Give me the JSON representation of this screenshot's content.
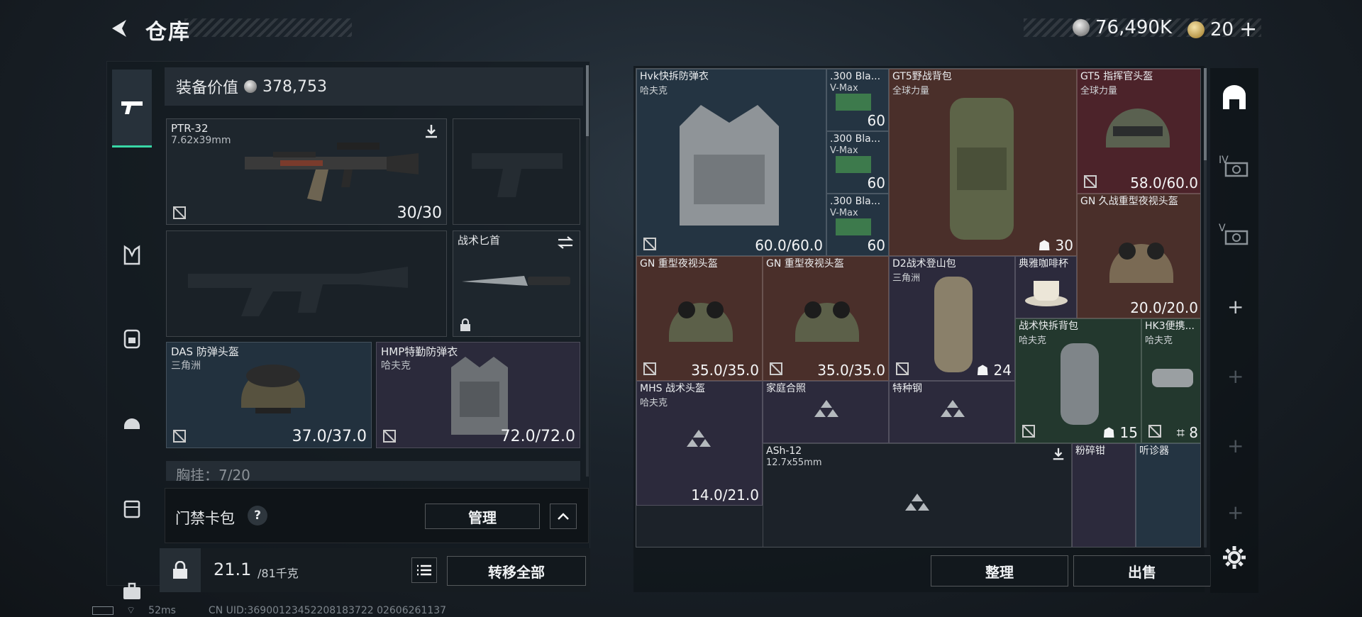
{
  "header": {
    "title": "仓库",
    "silver_amount": "76,490K",
    "gold_amount": "20",
    "gold_plus": "+"
  },
  "left": {
    "tabs": [
      "weapon-icon",
      "vest-icon",
      "backpack-icon",
      "helmet-icon",
      "case-icon",
      "briefcase-icon"
    ],
    "equipment_value_label": "装备价值",
    "equipment_value": "378,753",
    "primary": {
      "name": "PTR-32",
      "caliber": "7.62x39mm",
      "ammo": "30/30"
    },
    "melee": {
      "name": "战术匕首"
    },
    "helmet": {
      "name": "DAS 防弹头盔",
      "brand": "三角洲",
      "durability": "37.0/37.0"
    },
    "armor": {
      "name": "HMP特勤防弹衣",
      "brand": "哈夫克",
      "durability": "72.0/72.0"
    },
    "chest_rig_partial": "胸挂：7/20",
    "keycard": {
      "label": "门禁卡包",
      "help": "?",
      "manage": "管理"
    },
    "capacity": {
      "current": "21.1",
      "max": "/81千克",
      "transfer_all": "转移全部"
    }
  },
  "grid": {
    "items": [
      {
        "name": "Hvk快拆防弹衣",
        "sub": "哈夫克",
        "val": "60.0/60.0"
      },
      {
        "name": ".300 Bla...",
        "sub": "V-Max",
        "val": "60"
      },
      {
        "name": ".300 Bla...",
        "sub": "V-Max",
        "val": "60"
      },
      {
        "name": ".300 Bla...",
        "sub": "V-Max",
        "val": "60"
      },
      {
        "name": "GT5野战背包",
        "sub": "全球力量",
        "val": "30"
      },
      {
        "name": "GT5 指挥官头盔",
        "sub": "全球力量",
        "val": "58.0/60.0"
      },
      {
        "name": "GN 久战重型夜视头盔",
        "sub": "",
        "val": "20.0/20.0"
      },
      {
        "name": "GN 重型夜视头盔",
        "sub": "",
        "val": "35.0/35.0"
      },
      {
        "name": "GN 重型夜视头盔",
        "sub": "",
        "val": "35.0/35.0"
      },
      {
        "name": "D2战术登山包",
        "sub": "三角洲",
        "val": "24"
      },
      {
        "name": "典雅咖啡杯",
        "sub": "",
        "val": ""
      },
      {
        "name": "战术快拆背包",
        "sub": "哈夫克",
        "val": "15"
      },
      {
        "name": "HK3便携...",
        "sub": "哈夫克",
        "val": "8"
      },
      {
        "name": "MHS 战术头盔",
        "sub": "哈夫克",
        "val": "14.0/21.0"
      },
      {
        "name": "家庭合照",
        "sub": "",
        "val": ""
      },
      {
        "name": "特种钢",
        "sub": "",
        "val": ""
      },
      {
        "name": "ASh-12",
        "sub": "12.7x55mm",
        "val": ""
      },
      {
        "name": "粉碎钳",
        "sub": "",
        "val": ""
      },
      {
        "name": "听诊器",
        "sub": "",
        "val": ""
      }
    ],
    "sort": "整理",
    "sell": "出售"
  },
  "right_tabs": {
    "t4": "IV",
    "t5": "V"
  },
  "footer": {
    "ping": "52ms",
    "uid": "CN UID:36900123452208183722 02606261137"
  },
  "colors": {
    "accent": "#38d7a6",
    "gold_tier": "#4a2f2a",
    "purple_tier": "#2c2a3c",
    "red_tier": "#4c232a",
    "green_tier": "#23382e",
    "blue_tier": "#243442"
  }
}
